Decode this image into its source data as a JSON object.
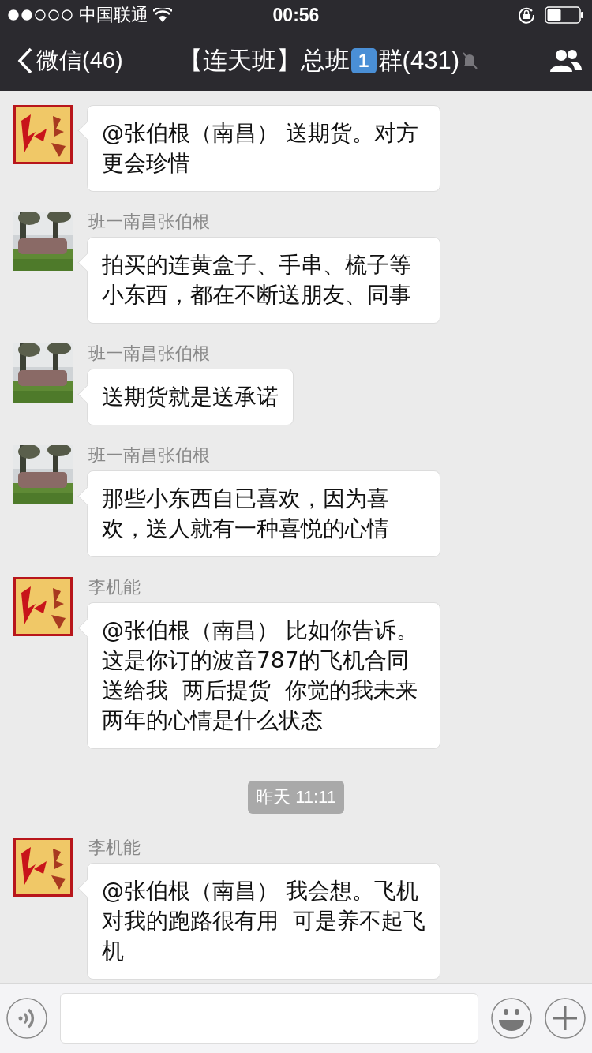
{
  "status_bar": {
    "carrier": "中国联通",
    "time": "00:56"
  },
  "nav": {
    "back": "微信(46)",
    "title_before": "【连天班】总班",
    "title_keycap": "1",
    "title_after": "群(431)",
    "muted": true
  },
  "messages": [
    {
      "kind": "message",
      "avatar": {
        "kind": "calligraphy"
      },
      "text": "@张伯根（南昌） 送期货。对方更会珍惜"
    },
    {
      "kind": "message",
      "sender": "班一南昌张伯根",
      "text": "拍买的连黄盒子、手串、梳子等小东西，都在不断送朋友、同事"
    },
    {
      "kind": "message",
      "sender": "班一南昌张伯根",
      "text": "送期货就是送承诺"
    },
    {
      "kind": "message",
      "sender": "班一南昌张伯根",
      "text": "那些小东西自已喜欢，因为喜欢，送人就有一种喜悦的心情"
    },
    {
      "kind": "message",
      "avatar": {
        "kind": "calligraphy"
      },
      "sender": "李机能",
      "text": "@张伯根（南昌） 比如你告诉。这是你订的波音787的飞机合同送给我  两后提货  你觉的我未来两年的心情是什么状态"
    },
    {
      "kind": "time",
      "text": "昨天 11:11"
    },
    {
      "kind": "message",
      "avatar": {
        "kind": "calligraphy"
      },
      "sender": "李机能",
      "text": "@张伯根（南昌） 我会想。飞机对我的跑路很有用  可是养不起飞机"
    }
  ]
}
